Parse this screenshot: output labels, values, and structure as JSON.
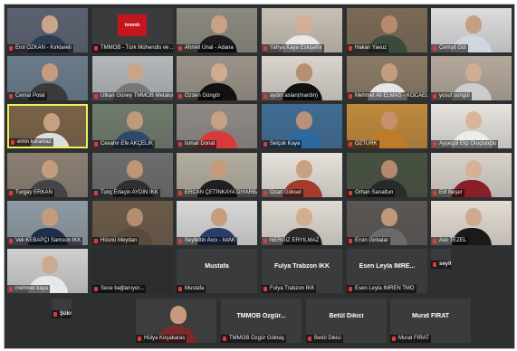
{
  "participants": [
    {
      "name": "Erol ÖZKAN - Kırklareli",
      "style": "video",
      "skin": "#c9a58a",
      "shirt": "#2d3c55",
      "bg": "#5b6170"
    },
    {
      "name": "TMMOB - Türk Mühendis ve ...",
      "style": "logo",
      "logo_text": "tmmob"
    },
    {
      "name": "Ahmet Ünal - Adana",
      "style": "video",
      "skin": "#caa187",
      "shirt": "#1c1c1c",
      "bg": "#8c8a7e"
    },
    {
      "name": "Yahya Kaya Eskişehir",
      "style": "video",
      "skin": "#d3b093",
      "shirt": "#e8e8e8",
      "bg": "#c7c0b3"
    },
    {
      "name": "Hakan Yavuz",
      "style": "video",
      "skin": "#b68b6d",
      "shirt": "#3c4a3e",
      "bg": "#7a6a55"
    },
    {
      "name": "Cemşit Gül",
      "style": "video",
      "skin": "#c59f82",
      "shirt": "#cfd6de",
      "bg": "#dcdcdc"
    },
    {
      "name": "Cemal Polat",
      "style": "video",
      "skin": "#c69c7e",
      "shirt": "#3a3a3a",
      "bg": "#6a7b8a"
    },
    {
      "name": "Utkan Güney TMMOB Metalur...",
      "style": "video",
      "skin": "#c9a486",
      "shirt": "#777777",
      "bg": "#b4b8bb"
    },
    {
      "name": "Özden Güngör",
      "style": "video",
      "skin": "#d1ab8d",
      "shirt": "#111111",
      "bg": "#9a9388"
    },
    {
      "name": "aydın aslan(mardin)",
      "style": "video",
      "skin": "#b88e70",
      "shirt": "#111111",
      "bg": "#d9d4cc"
    },
    {
      "name": "Mehmet Ali ELMAS - KOCAELİ",
      "style": "video",
      "skin": "#c49d80",
      "shirt": "#e5e5e5",
      "bg": "#8a7a65"
    },
    {
      "name": "yusuf songül",
      "style": "video",
      "skin": "#cfad92",
      "shirt": "#cccccc",
      "bg": "#b3a89a"
    },
    {
      "name": "emin koramaz",
      "style": "video",
      "skin": "#c8a082",
      "shirt": "#dddddd",
      "bg": "#7a6246",
      "active": true
    },
    {
      "name": "Cevahir Efe AKÇELİK",
      "style": "video",
      "skin": "#c19a7c",
      "shirt": "#2d4a6a",
      "bg": "#6f7b6c"
    },
    {
      "name": "İsmail Donat",
      "style": "video",
      "skin": "#c4a084",
      "shirt": "#d83a3a",
      "bg": "#8f8a86"
    },
    {
      "name": "Selçuk Kaya",
      "style": "video",
      "skin": "#b7917a",
      "shirt": "#2a6aa0",
      "bg": "#3f6c94"
    },
    {
      "name": "ÖZTÜRK",
      "style": "video",
      "skin": "#c89070",
      "shirt": "#c07a2a",
      "bg": "#c0893a"
    },
    {
      "name": "Ayşegül Elçi Oruçluoğlu",
      "style": "video",
      "skin": "#d9b49a",
      "shirt": "#ececec",
      "bg": "#e6e3de"
    },
    {
      "name": "Turgay ERKAN",
      "style": "video",
      "skin": "#c49c7e",
      "shirt": "#444444",
      "bg": "#8b7f72"
    },
    {
      "name": "Tunç Erlaçin AYDIN İKK",
      "style": "video",
      "skin": "#bf9577",
      "shirt": "#2f2f2f",
      "bg": "#6c6c6c"
    },
    {
      "name": "ERCAN ÇETİNKAYA DİYARBAKIR",
      "style": "video",
      "skin": "#c59b7c",
      "shirt": "#1f1f1f",
      "bg": "#b2ad9f"
    },
    {
      "name": "Ozan Göksel",
      "style": "video",
      "skin": "#c9a082",
      "shirt": "#a53b2b",
      "bg": "#e5e1da"
    },
    {
      "name": "Orhan Sarıaltun",
      "style": "video",
      "skin": "#b38a6d",
      "shirt": "#2a2a2a",
      "bg": "#47513f"
    },
    {
      "name": "Elif Beşer",
      "style": "video",
      "skin": "#d6b197",
      "shirt": "#8a1f2a",
      "bg": "#d8d2cb"
    },
    {
      "name": "Veli KEBAPÇI Samsun İKK",
      "style": "video",
      "skin": "#c39b7d",
      "shirt": "#1f2f4a",
      "bg": "#8e9aa4"
    },
    {
      "name": "Hüsnü Meydan",
      "style": "video",
      "skin": "#b48c70",
      "shirt": "#5a4a3a",
      "bg": "#6a5a48"
    },
    {
      "name": "Seyfettin Avcı - İstAK",
      "style": "video",
      "skin": "#c79d7f",
      "shirt": "#2a3d6a",
      "bg": "#d8d8d8"
    },
    {
      "name": "NERGİZ ERYILMAZ",
      "style": "video",
      "skin": "#d4ac90",
      "shirt": "#2a2a2a",
      "bg": "#dedad3"
    },
    {
      "name": "Ersin Girbalar",
      "style": "video",
      "skin": "#c0977a",
      "shirt": "#6a6a6a",
      "bg": "#5a5654"
    },
    {
      "name": "Aslı TEZEL",
      "style": "video",
      "skin": "#d0aa8f",
      "shirt": "#1a1a1a",
      "bg": "#e3dcd3"
    },
    {
      "name": "mehmet kaya",
      "style": "video",
      "skin": "#ccaa8f",
      "shirt": "#e8e8e8",
      "bg": "#cfcfcf"
    },
    {
      "name": "Sese bağlanıyor...",
      "style": "blank"
    },
    {
      "name": "Mustafa",
      "style": "name",
      "big": "Mustafa"
    },
    {
      "name": "Fulya Trabzon İKK",
      "style": "name",
      "big": "Fulya Trabzon İKK"
    },
    {
      "name": "Esen Leyla İMREN TMO",
      "style": "name",
      "big": "Esen Leyla İMRE..."
    },
    {
      "name": "seyit ali korkmaz",
      "style": "avatar",
      "letter": "S",
      "color": "#f05a22"
    },
    {
      "name": "Şükrü Akçadağ",
      "style": "avatar",
      "letter": "Ş",
      "color": "#1f8a6a"
    },
    {
      "name": "Hülya Koçakaras",
      "style": "video",
      "skin": "#c89a7e",
      "shirt": "#7a2a2a",
      "bg": "#3d3d3d"
    },
    {
      "name": "TMMOB Özgür Göktaş",
      "style": "name",
      "big": "TMMOB  Özgür..."
    },
    {
      "name": "Betül Dikici",
      "style": "name",
      "big": "Betül Dikici"
    },
    {
      "name": "Murat FIRAT",
      "style": "name",
      "big": "Murat FIRAT"
    }
  ]
}
